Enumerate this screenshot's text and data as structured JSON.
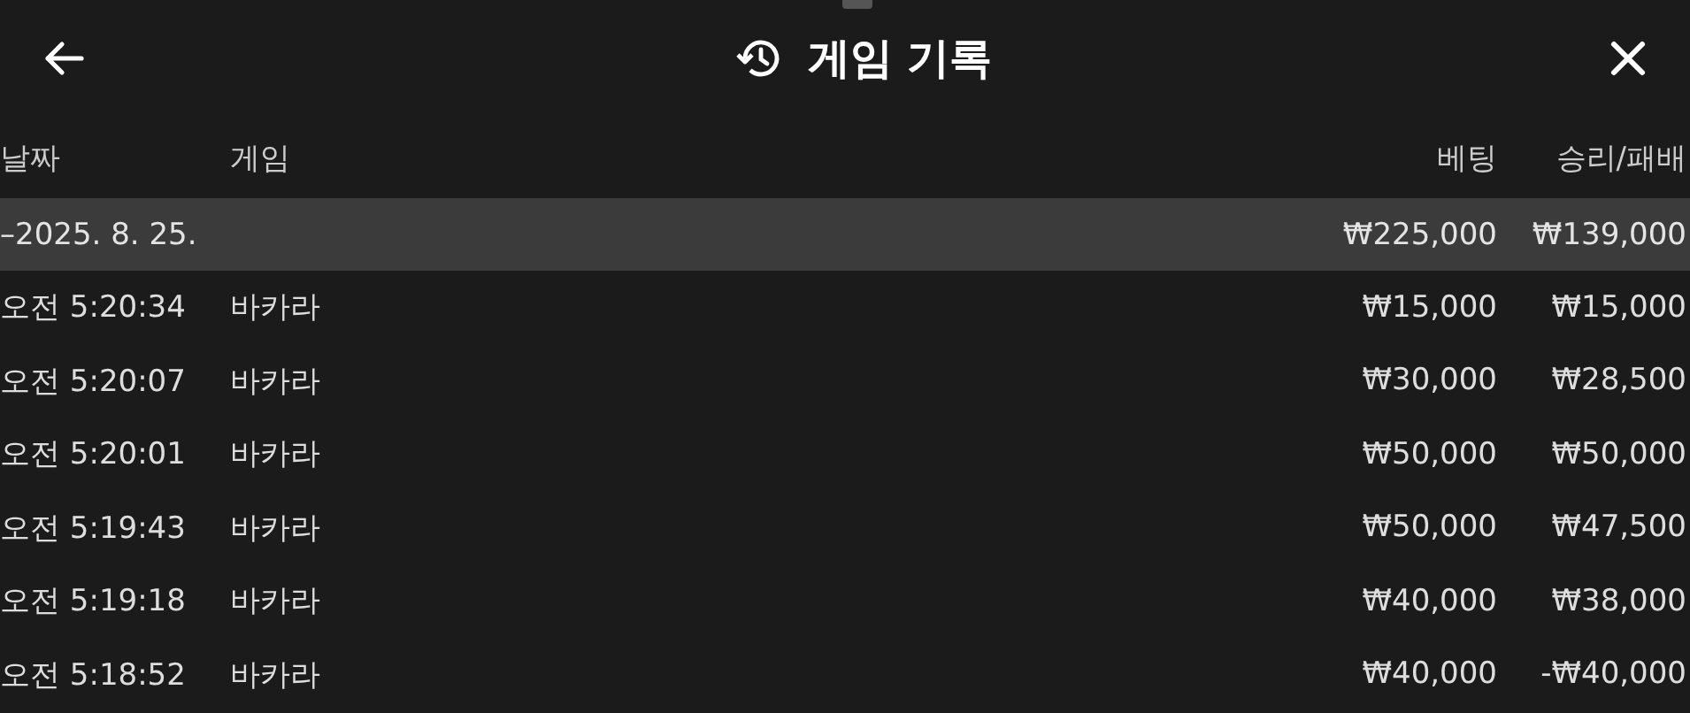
{
  "header": {
    "title": "게임 기록"
  },
  "table": {
    "columns": [
      "날짜",
      "게임",
      "베팅",
      "승리/패배"
    ],
    "group": {
      "date": "–2025. 8. 25.",
      "bet": "₩225,000",
      "result": "₩139,000"
    },
    "rows": [
      {
        "time": "오전 5:20:34",
        "game": "바카라",
        "bet": "₩15,000",
        "result": "₩15,000"
      },
      {
        "time": "오전 5:20:07",
        "game": "바카라",
        "bet": "₩30,000",
        "result": "₩28,500"
      },
      {
        "time": "오전 5:20:01",
        "game": "바카라",
        "bet": "₩50,000",
        "result": "₩50,000"
      },
      {
        "time": "오전 5:19:43",
        "game": "바카라",
        "bet": "₩50,000",
        "result": "₩47,500"
      },
      {
        "time": "오전 5:19:18",
        "game": "바카라",
        "bet": "₩40,000",
        "result": "₩38,000"
      },
      {
        "time": "오전 5:18:52",
        "game": "바카라",
        "bet": "₩40,000",
        "result": "-₩40,000"
      }
    ]
  }
}
